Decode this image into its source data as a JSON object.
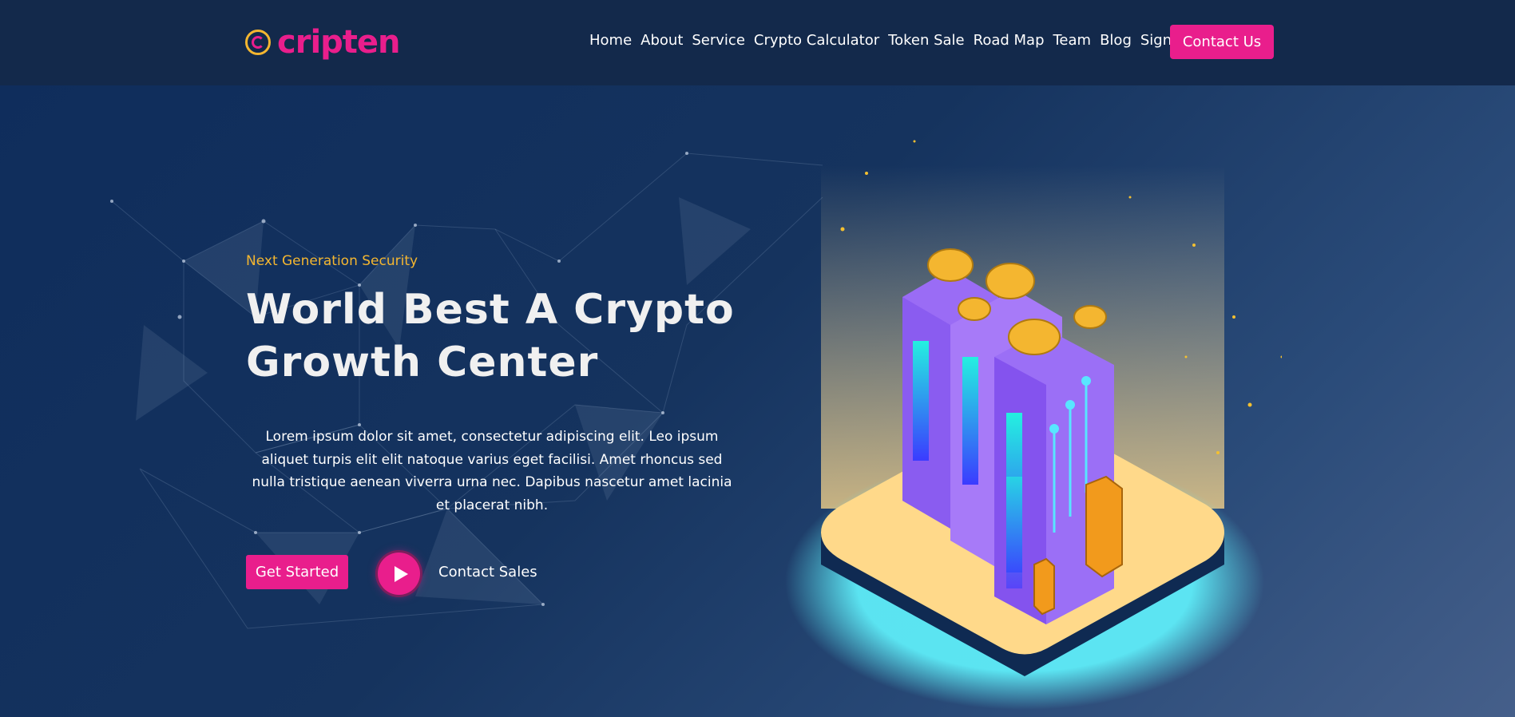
{
  "brand": {
    "name": "cripten",
    "colors": {
      "accent": "#e91e8c",
      "gold": "#f4b630",
      "navy": "#13294b"
    }
  },
  "nav": {
    "items": [
      "Home",
      "About",
      "Service",
      "Crypto Calculator",
      "Token Sale",
      "Road Map",
      "Team",
      "Blog",
      "Sign"
    ],
    "contact_label": "Contact Us"
  },
  "hero": {
    "eyebrow": "Next Generation Security",
    "title_line1": "World Best A Crypto",
    "title_line2": "Growth Center",
    "description": "Lorem ipsum dolor sit amet, consectetur adipiscing elit. Leo ipsum aliquet turpis elit elit natoque varius eget facilisi. Amet rhoncus sed nulla tristique aenean viverra urna nec. Dapibus nascetur amet lacinia et placerat nibh.",
    "primary_button": "Get Started",
    "secondary_link": "Contact Sales",
    "play_icon": "play-icon",
    "illustration": "isometric-bitcoin-mining-servers"
  }
}
